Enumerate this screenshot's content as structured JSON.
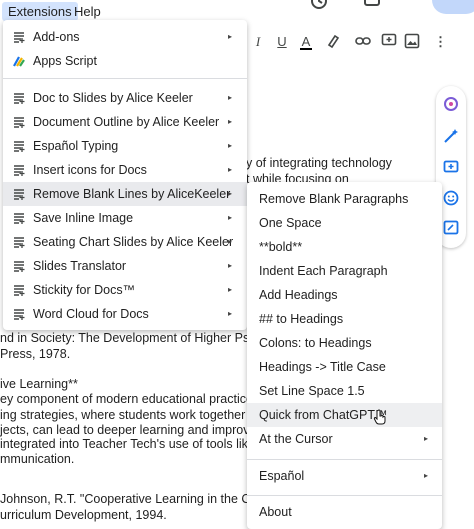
{
  "menubar": {
    "extensions": "Extensions",
    "help": "Help"
  },
  "toolbar": {
    "italic": "I",
    "underline": "U",
    "text_color": "A",
    "more": "⋮"
  },
  "extensions_menu": {
    "items": [
      {
        "label": "Add-ons",
        "icon": "addon-icon",
        "arrow": "▸"
      },
      {
        "label": "Apps Script",
        "icon": "apps-script-icon",
        "arrow": ""
      },
      {
        "label": "Doc to Slides by Alice Keeler",
        "icon": "addon-icon",
        "arrow": "▸"
      },
      {
        "label": "Document Outline by Alice Keeler",
        "icon": "addon-icon",
        "arrow": "▸"
      },
      {
        "label": "Español Typing",
        "icon": "addon-icon",
        "arrow": "▸"
      },
      {
        "label": "Insert icons for Docs",
        "icon": "addon-icon",
        "arrow": "▸"
      },
      {
        "label": "Remove Blank Lines by AliceKeeler",
        "icon": "addon-icon",
        "arrow": "▸"
      },
      {
        "label": "Save Inline Image",
        "icon": "addon-icon",
        "arrow": "▸"
      },
      {
        "label": "Seating Chart Slides by Alice Keeler",
        "icon": "addon-icon",
        "arrow": "▸"
      },
      {
        "label": "Slides Translator",
        "icon": "addon-icon",
        "arrow": "▸"
      },
      {
        "label": "Stickity for Docs™",
        "icon": "addon-icon",
        "arrow": "▸"
      },
      {
        "label": "Word Cloud for Docs",
        "icon": "addon-icon",
        "arrow": "▸"
      }
    ]
  },
  "submenu": {
    "items": [
      {
        "label": "Remove Blank Paragraphs",
        "arrow": ""
      },
      {
        "label": "One Space",
        "arrow": ""
      },
      {
        "label": "**bold**",
        "arrow": ""
      },
      {
        "label": "Indent Each Paragraph",
        "arrow": ""
      },
      {
        "label": "Add Headings",
        "arrow": ""
      },
      {
        "label": "## to Headings",
        "arrow": ""
      },
      {
        "label": "Colons: to Headings",
        "arrow": ""
      },
      {
        "label": "Headings -> Title Case",
        "arrow": ""
      },
      {
        "label": "Set Line Space 1.5",
        "arrow": ""
      },
      {
        "label": "Quick from ChatGPT™",
        "arrow": ""
      },
      {
        "label": "At the Cursor",
        "arrow": "▸"
      },
      {
        "label": "Español",
        "arrow": "▸"
      },
      {
        "label": "About",
        "arrow": ""
      }
    ]
  },
  "document": {
    "right_lines": [
      "y of integrating technology",
      "t while focusing on"
    ],
    "left_lines": [
      "nd in Society: The Development of Higher Psychol",
      "Press, 1978.",
      "ive Learning**",
      "ey component of modern educational practices. Re",
      "ing strategies, where students work together to solv",
      "jects, can lead to deeper learning and improved ac",
      " integrated into Teacher Tech's use of tools like Go",
      "mmunication.",
      " Johnson, R.T. \"Cooperative Learning in the Classr",
      "urriculum Development, 1994."
    ]
  },
  "colors": {
    "menu_active": "#d3e3fd",
    "hover": "#e9eaed",
    "accent": "#1a73e8"
  }
}
